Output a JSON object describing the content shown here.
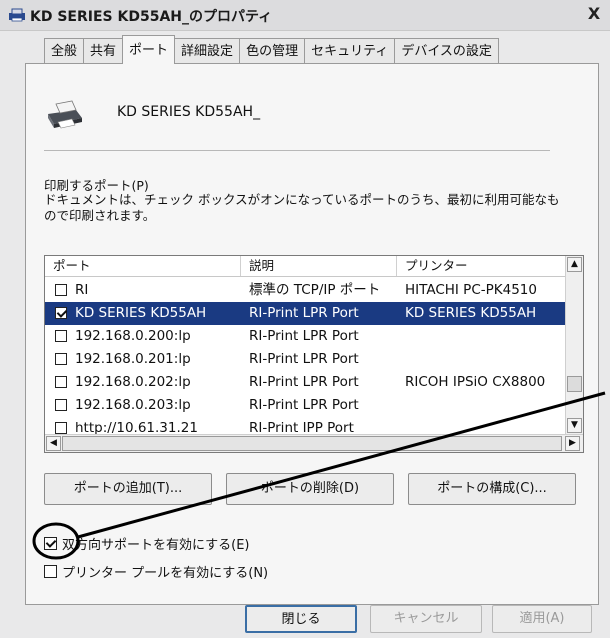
{
  "window": {
    "title": "KD SERIES KD55AH_のプロパティ",
    "close_label": "X"
  },
  "tabs": [
    {
      "label": "全般"
    },
    {
      "label": "共有"
    },
    {
      "label": "ポート",
      "active": true
    },
    {
      "label": "詳細設定"
    },
    {
      "label": "色の管理"
    },
    {
      "label": "セキュリティ"
    },
    {
      "label": "デバイスの設定"
    }
  ],
  "printer": {
    "name": "KD SERIES KD55AH_",
    "icon": "printer-icon"
  },
  "port_section": {
    "label": "印刷するポート(P)",
    "description": "ドキュメントは、チェック ボックスがオンになっているポートのうち、最初に利用可能なもので印刷されます。"
  },
  "port_list": {
    "columns": [
      "ポート",
      "説明",
      "プリンター"
    ],
    "rows": [
      {
        "port": "RI",
        "desc": "標準の TCP/IP ポート",
        "printer": "HITACHI PC-PK4510",
        "checked": false,
        "selected": false
      },
      {
        "port": "KD SERIES KD55AH",
        "desc": "RI-Print LPR Port",
        "printer": "KD SERIES KD55AH",
        "checked": true,
        "selected": true
      },
      {
        "port": "192.168.0.200:lp",
        "desc": "RI-Print LPR Port",
        "printer": "",
        "checked": false,
        "selected": false
      },
      {
        "port": "192.168.0.201:lp",
        "desc": "RI-Print LPR Port",
        "printer": "",
        "checked": false,
        "selected": false
      },
      {
        "port": "192.168.0.202:lp",
        "desc": "RI-Print LPR Port",
        "printer": "RICOH IPSiO CX8800",
        "checked": false,
        "selected": false
      },
      {
        "port": "192.168.0.203:lp",
        "desc": "RI-Print LPR Port",
        "printer": "",
        "checked": false,
        "selected": false
      },
      {
        "port": "http://10.61.31.21",
        "desc": "RI-Print IPP Port",
        "printer": "",
        "checked": false,
        "selected": false
      }
    ]
  },
  "buttons": {
    "add_port": "ポートの追加(T)...",
    "delete_port": "ポートの削除(D)",
    "configure_port": "ポートの構成(C)..."
  },
  "options": {
    "bidirectional": {
      "label": "双方向サポートを有効にする(E)",
      "checked": true
    },
    "pooling": {
      "label": "プリンター プールを有効にする(N)",
      "checked": false
    }
  },
  "footer": {
    "close": "閉じる",
    "cancel": "キャンセル",
    "apply": "適用(A)"
  },
  "colors": {
    "selection": "#1a3a82",
    "annotation": "#000000"
  }
}
